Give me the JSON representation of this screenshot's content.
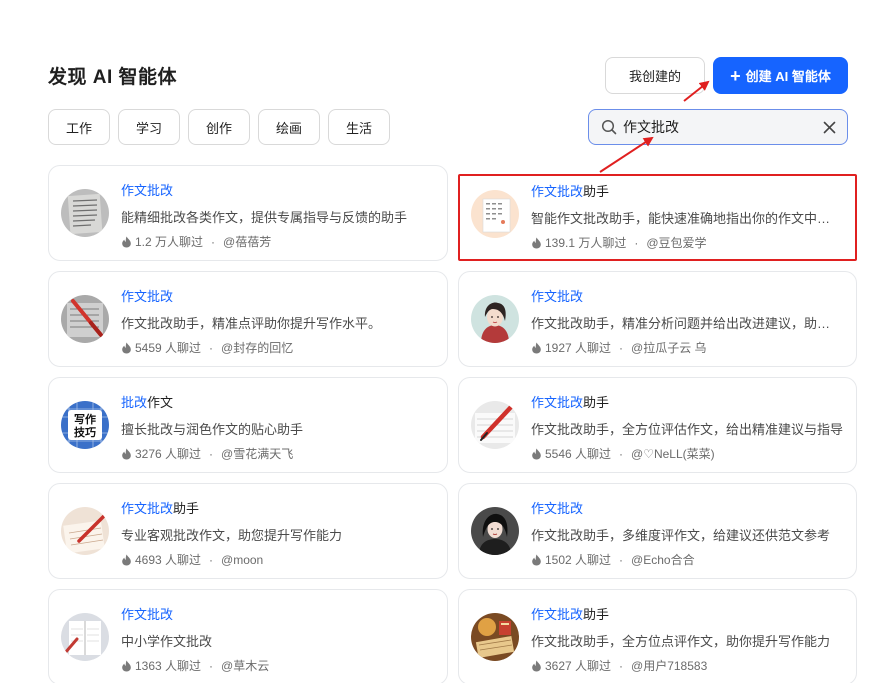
{
  "header": {
    "title": "发现 AI 智能体",
    "my_created_label": "我创建的",
    "create_label": "创建 AI 智能体"
  },
  "filters": [
    "工作",
    "学习",
    "创作",
    "绘画",
    "生活"
  ],
  "search": {
    "value": "作文批改"
  },
  "colors": {
    "accent": "#1664ff",
    "highlight_box": "#e02020"
  },
  "cards": [
    {
      "title_hit": "作文批改",
      "title_rest": "",
      "desc": "能精细批改各类作文，提供专属指导与反馈的助手",
      "count": "1.2 万人聊过",
      "author": "@蓓蓓芳",
      "avatar": "paper-photo"
    },
    {
      "title_hit": "作文批改",
      "title_rest": "助手",
      "desc": "智能作文批改助手，能快速准确地指出你的作文中的问题",
      "count": "139.1 万人聊过",
      "author": "@豆包爱学",
      "avatar": "essay-sheet"
    },
    {
      "title_hit": "作文批改",
      "title_rest": "",
      "desc": "作文批改助手，精准点评助你提升写作水平。",
      "count": "5459 人聊过",
      "author": "@封存的回忆",
      "avatar": "red-pen"
    },
    {
      "title_hit": "作文批改",
      "title_rest": "",
      "desc": "作文批改助手，精准分析问题并给出改进建议，助你进步",
      "count": "1927 人聊过",
      "author": "@拉瓜子云 乌",
      "avatar": "portrait-girl"
    },
    {
      "title_hit": "批改",
      "title_rest": "作文",
      "desc": "擅长批改与润色作文的贴心助手",
      "count": "3276 人聊过",
      "author": "@雪花满天飞",
      "avatar": "writing-tips"
    },
    {
      "title_hit": "作文批改",
      "title_rest": "助手",
      "desc": "作文批改助手，全方位评估作文，给出精准建议与指导",
      "count": "5546 人聊过",
      "author": "@♡NeLL(菜菜)",
      "avatar": "red-pen-2"
    },
    {
      "title_hit": "作文批改",
      "title_rest": "助手",
      "desc": "专业客观批改作文，助您提升写作能力",
      "count": "4693 人聊过",
      "author": "@moon",
      "avatar": "pen-paper"
    },
    {
      "title_hit": "作文批改",
      "title_rest": "",
      "desc": "作文批改助手，多维度评作文，给建议还供范文参考",
      "count": "1502 人聊过",
      "author": "@Echo合合",
      "avatar": "portrait-dark"
    },
    {
      "title_hit": "作文批改",
      "title_rest": "",
      "desc": "中小学作文批改",
      "count": "1363 人聊过",
      "author": "@草木云",
      "avatar": "notebook"
    },
    {
      "title_hit": "作文批改",
      "title_rest": "助手",
      "desc": "作文批改助手，全方位点评作文，助你提升写作能力",
      "count": "3627 人聊过",
      "author": "@用户718583",
      "avatar": "desk-warm"
    }
  ]
}
